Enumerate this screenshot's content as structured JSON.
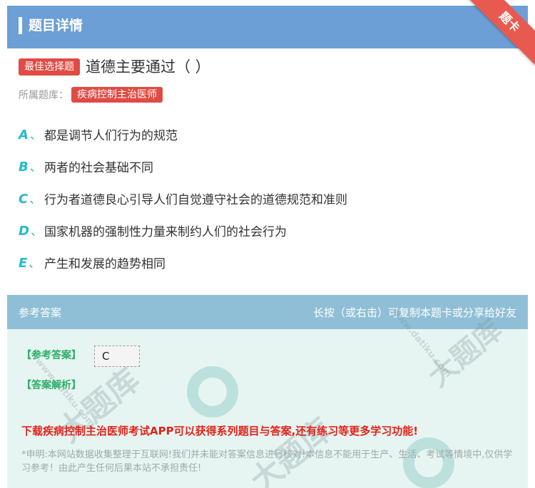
{
  "header": {
    "title": "题目详情",
    "corner_ribbon": "题卡"
  },
  "question": {
    "tag": "最佳选择题",
    "text": "道德主要通过（ ）",
    "bank_label": "所属题库：",
    "bank_name": "疾病控制主治医师"
  },
  "options": [
    {
      "letter": "A",
      "sep": "、",
      "text": "都是调节人们行为的规范"
    },
    {
      "letter": "B",
      "sep": "、",
      "text": "两者的社会基础不同"
    },
    {
      "letter": "C",
      "sep": "、",
      "text": "行为者道德良心引导人们自觉遵守社会的道德规范和准则"
    },
    {
      "letter": "D",
      "sep": "、",
      "text": "国家机器的强制性力量来制约人们的社会行为"
    },
    {
      "letter": "E",
      "sep": "、",
      "text": "产生和发展的趋势相同"
    }
  ],
  "answer": {
    "title": "参考答案",
    "hint": "长按（或右击）可复制本题卡或分享给好友",
    "answer_label": "【参考答案】",
    "answer_value": "C",
    "analysis_label": "【答案解析】",
    "promo": "下载疾病控制主治医师考试APP可以获得系列题目与答案,还有练习等更多学习功能!",
    "notice": "*申明:本网站数据收集整理于互联网!我们并未能对答案信息进行核对!本信息不能用于生产、生活、考试等情境中,仅供学习参考！由此产生任何后果本站不承担责任!"
  },
  "watermark": {
    "brand": "大题库",
    "url": "www.datiku.com"
  },
  "colors": {
    "header": "#6b9fd6",
    "accent_red": "#e04b44",
    "option_letter": "#25b9cf",
    "answer_green": "#2eae6a",
    "promo_red": "#e2231a"
  }
}
